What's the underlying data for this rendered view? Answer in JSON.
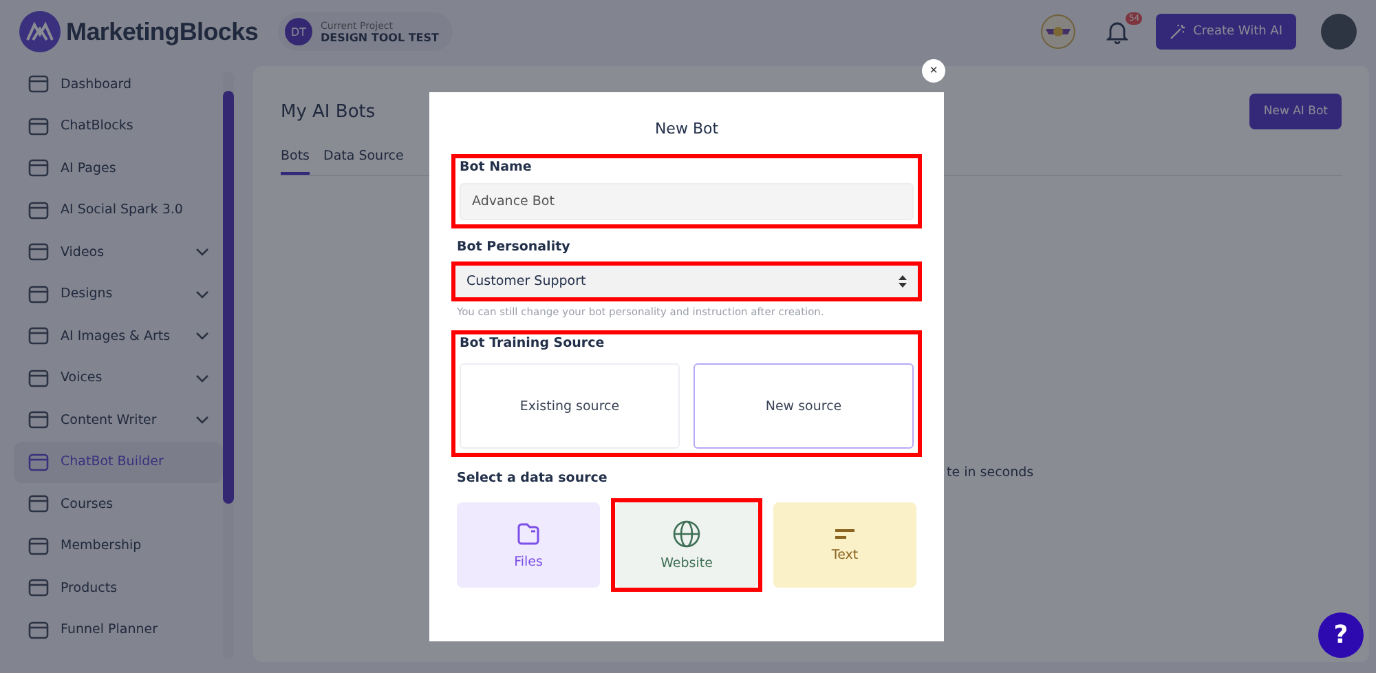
{
  "header": {
    "logo": "MarketingBlocks",
    "project": {
      "initials": "DT",
      "caption": "Current Project",
      "name": "DESIGN TOOL TEST"
    },
    "notification_count": "54",
    "create_button": "Create With AI"
  },
  "sidebar": {
    "items": [
      {
        "label": "Dashboard",
        "selected": false,
        "expandable": false
      },
      {
        "label": "ChatBlocks",
        "selected": false,
        "expandable": false
      },
      {
        "label": "AI Pages",
        "selected": false,
        "expandable": false
      },
      {
        "label": "AI Social Spark 3.0",
        "selected": false,
        "expandable": false
      },
      {
        "label": "Videos",
        "selected": false,
        "expandable": true
      },
      {
        "label": "Designs",
        "selected": false,
        "expandable": true
      },
      {
        "label": "AI Images & Arts",
        "selected": false,
        "expandable": true
      },
      {
        "label": "Voices",
        "selected": false,
        "expandable": true
      },
      {
        "label": "Content Writer",
        "selected": false,
        "expandable": true
      },
      {
        "label": "ChatBot Builder",
        "selected": true,
        "expandable": false
      },
      {
        "label": "Courses",
        "selected": false,
        "expandable": false
      },
      {
        "label": "Membership",
        "selected": false,
        "expandable": false
      },
      {
        "label": "Products",
        "selected": false,
        "expandable": false
      },
      {
        "label": "Funnel Planner",
        "selected": false,
        "expandable": false
      }
    ]
  },
  "page": {
    "title": "My AI Bots",
    "new_button": "New AI Bot",
    "tabs": [
      {
        "label": "Bots",
        "selected": true
      },
      {
        "label": "Data Source",
        "selected": false
      }
    ],
    "hint_fragment": "te in seconds"
  },
  "modal": {
    "close": "×",
    "title": "New Bot",
    "name_field": {
      "label": "Bot Name",
      "value": "Advance Bot",
      "highlighted": true
    },
    "personality": {
      "label": "Bot Personality",
      "value": "Customer Support",
      "note": "You can still change your bot personality and instruction after creation.",
      "highlighted": true
    },
    "training": {
      "label": "Bot Training Source",
      "highlighted": true,
      "options": [
        {
          "label": "Existing source",
          "selected": false
        },
        {
          "label": "New source",
          "selected": true
        }
      ]
    },
    "data_source": {
      "label": "Select a data source",
      "options": [
        {
          "label": "Files",
          "kind": "files",
          "highlighted": false
        },
        {
          "label": "Website",
          "kind": "website",
          "highlighted": true
        },
        {
          "label": "Text",
          "kind": "text",
          "highlighted": false
        }
      ]
    }
  },
  "help": "?"
}
